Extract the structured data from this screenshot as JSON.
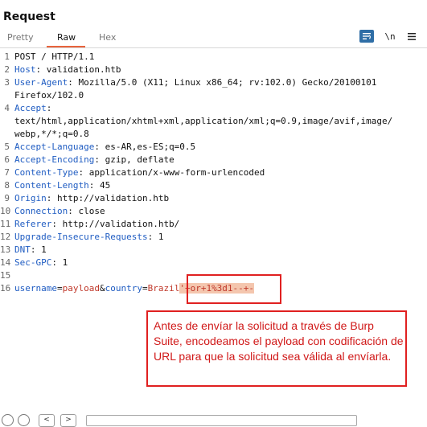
{
  "panel": {
    "title": "Request"
  },
  "tabs": [
    {
      "label": "Pretty",
      "active": false
    },
    {
      "label": "Raw",
      "active": true
    },
    {
      "label": "Hex",
      "active": false
    }
  ],
  "toolbar": {
    "wrap_icon": "text-wrap-icon",
    "newline_label": "\\n",
    "menu_icon": "hamburger-menu-icon"
  },
  "request": {
    "request_line": "POST / HTTP/1.1",
    "headers": [
      {
        "name": "Host",
        "value": "validation.htb"
      },
      {
        "name": "User-Agent",
        "value": "Mozilla/5.0 (X11; Linux x86_64; rv:102.0) Gecko/20100101",
        "cont": "Firefox/102.0"
      },
      {
        "name": "Accept",
        "value": "",
        "cont": "text/html,application/xhtml+xml,application/xml;q=0.9,image/avif,image/",
        "cont2": "webp,*/*;q=0.8"
      },
      {
        "name": "Accept-Language",
        "value": "es-AR,es-ES;q=0.5"
      },
      {
        "name": "Accept-Encoding",
        "value": "gzip, deflate"
      },
      {
        "name": "Content-Type",
        "value": "application/x-www-form-urlencoded"
      },
      {
        "name": "Content-Length",
        "value": "45"
      },
      {
        "name": "Origin",
        "value": "http://validation.htb"
      },
      {
        "name": "Connection",
        "value": "close"
      },
      {
        "name": "Referer",
        "value": "http://validation.htb/"
      },
      {
        "name": "Upgrade-Insecure-Requests",
        "value": "1"
      },
      {
        "name": "DNT",
        "value": "1"
      },
      {
        "name": "Sec-GPC",
        "value": "1"
      }
    ],
    "line_numbers": [
      "1",
      "2",
      "3",
      "4",
      "5",
      "6",
      "7",
      "8",
      "9",
      "10",
      "11",
      "12",
      "13",
      "14",
      "15",
      "16"
    ],
    "body": {
      "p1_key": "username",
      "p1_val": "payload",
      "amp": "&",
      "p2_key": "country",
      "p2_val": "Brazil",
      "payload": "'+or+1%3d1--+-"
    }
  },
  "annotation": {
    "text": "Antes de envíar la solicitud a través de Burp Suite, encodeamos el payload con codificación de URL para que la solicitud sea válida al envíarla.",
    "color": "#e02020"
  },
  "bottom_bar": {
    "icons": [
      "help-icon",
      "settings-icon"
    ],
    "prev_label": "<",
    "next_label": ">"
  }
}
